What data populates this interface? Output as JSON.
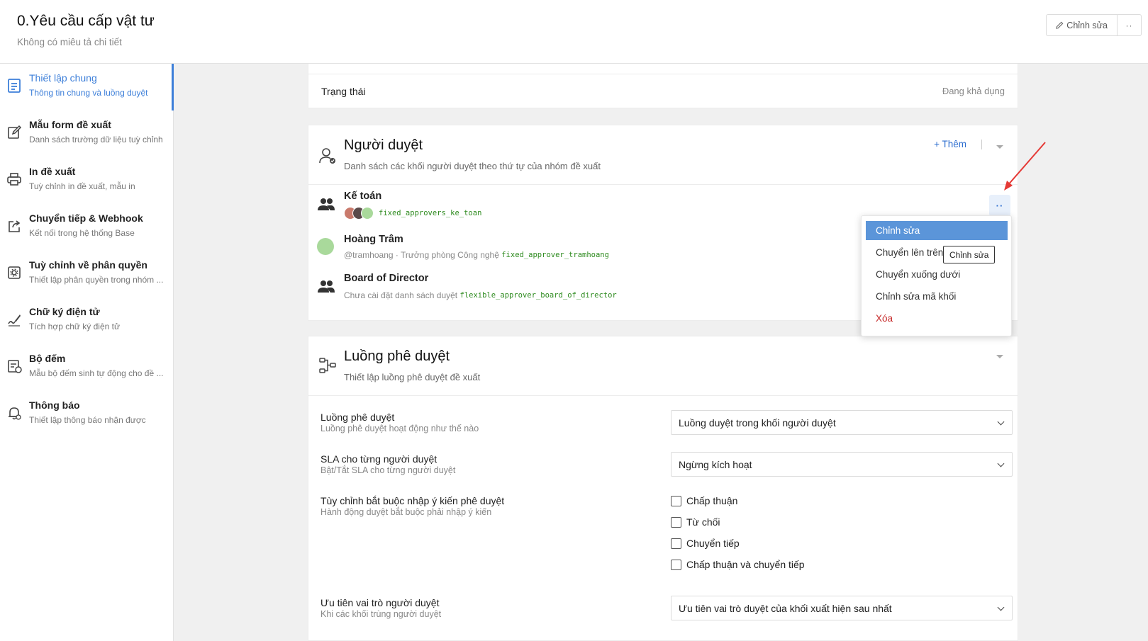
{
  "header": {
    "title": "0.Yêu cầu cấp vật tư",
    "subtitle": "Không có miêu tả chi tiết",
    "edit_label": "Chỉnh sửa",
    "more_label": "··"
  },
  "sidebar": {
    "items": [
      {
        "label": "Thiết lập chung",
        "desc": "Thông tin chung và luồng duyệt",
        "icon": "document-icon",
        "active": true
      },
      {
        "label": "Mẫu form đề xuất",
        "desc": "Danh sách trường dữ liệu tuỳ chỉnh",
        "icon": "edit-form-icon"
      },
      {
        "label": "In đề xuất",
        "desc": "Tuỳ chỉnh in đề xuất, mẫu in",
        "icon": "printer-icon"
      },
      {
        "label": "Chuyển tiếp & Webhook",
        "desc": "Kết nối trong hệ thống Base",
        "icon": "share-icon"
      },
      {
        "label": "Tuỳ chỉnh về phân quyền",
        "desc": "Thiết lập phân quyền trong nhóm ...",
        "icon": "settings-icon"
      },
      {
        "label": "Chữ ký điện tử",
        "desc": "Tích hợp chữ ký điện tử",
        "icon": "signature-icon"
      },
      {
        "label": "Bộ đếm",
        "desc": "Mẫu bộ đếm sinh tự động cho đề ...",
        "icon": "counter-icon"
      },
      {
        "label": "Thông báo",
        "desc": "Thiết lập thông báo nhận được",
        "icon": "bell-icon"
      }
    ]
  },
  "status": {
    "label": "Trạng thái",
    "value": "Đang khả dụng"
  },
  "approvers": {
    "title": "Người duyệt",
    "desc": "Danh sách các khối người duyệt theo thứ tự của nhóm đề xuất",
    "add_label": "+ Thêm",
    "list": [
      {
        "name": "Kế toán",
        "code": "fixed_approvers_ke_toan"
      },
      {
        "name": "Hoàng Trâm",
        "handle": "@tramhoang",
        "meta": " · Trưởng phòng Công nghệ ",
        "code": "fixed_approver_tramhoang"
      },
      {
        "name": "Board of Director",
        "meta": "Chưa cài đặt danh sách duyệt ",
        "code": "flexible_approver_board_of_director"
      }
    ],
    "more_label": "··"
  },
  "menu": {
    "items": [
      "Chỉnh sửa",
      "Chuyển lên trên",
      "Chuyển xuống dưới",
      "Chỉnh sửa mã khối",
      "Xóa"
    ],
    "tooltip": "Chỉnh sửa"
  },
  "flow": {
    "title": "Luồng phê duyệt",
    "desc": "Thiết lập luồng phê duyệt đề xuất",
    "rows": [
      {
        "label": "Luồng phê duyệt",
        "help": "Luồng phê duyệt hoạt động như thế nào",
        "value": "Luồng duyệt trong khối người duyệt"
      },
      {
        "label": "SLA cho từng người duyệt",
        "help": "Bật/Tắt SLA cho từng người duyệt",
        "value": "Ngừng kích hoạt"
      },
      {
        "label": "Tùy chỉnh bắt buộc nhập ý kiến phê duyệt",
        "help": "Hành động duyệt bắt buộc phải nhập ý kiến"
      },
      {
        "label": "Ưu tiên vai trò người duyệt",
        "help": "Khi các khối trùng người duyệt",
        "value": "Ưu tiên vai trò duyệt của khối xuất hiện sau nhất"
      }
    ],
    "checkboxes": [
      "Chấp thuận",
      "Từ chối",
      "Chuyển tiếp",
      "Chấp thuận và chuyển tiếp"
    ]
  },
  "colors": {
    "accent": "#3d7fd9",
    "menu_active": "#5b95d9",
    "danger": "#c62828",
    "code_green": "#2e8b1f",
    "annotation_arrow": "#e53935"
  }
}
